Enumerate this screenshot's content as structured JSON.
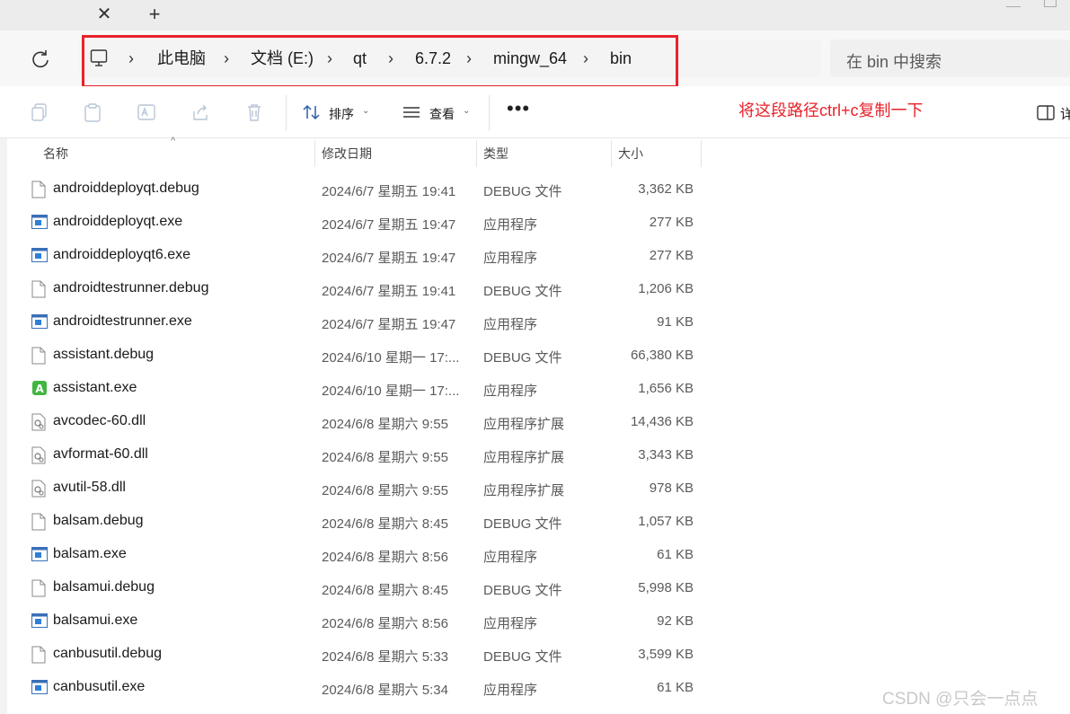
{
  "tabs": {
    "close_glyph": "✕",
    "new_glyph": "+"
  },
  "address": {
    "breadcrumbs": [
      "此电脑",
      "文档 (E:)",
      "qt",
      "6.7.2",
      "mingw_64",
      "bin"
    ],
    "separator": "›",
    "search_placeholder": "在 bin 中搜索",
    "highlight_color": "#e8222a"
  },
  "toolbar": {
    "sort_label": "排序",
    "view_label": "查看",
    "more_label": "•••",
    "detail_label": "详",
    "annotation": "将这段路径ctrl+c复制一下"
  },
  "columns": {
    "name": "名称",
    "date": "修改日期",
    "type": "类型",
    "size": "大小"
  },
  "files": [
    {
      "name": "androiddeployqt.debug",
      "date": "2024/6/7 星期五 19:41",
      "type": "DEBUG 文件",
      "size": "3,362 KB",
      "icon": "document-icon"
    },
    {
      "name": "androiddeployqt.exe",
      "date": "2024/6/7 星期五 19:47",
      "type": "应用程序",
      "size": "277 KB",
      "icon": "exe-icon"
    },
    {
      "name": "androiddeployqt6.exe",
      "date": "2024/6/7 星期五 19:47",
      "type": "应用程序",
      "size": "277 KB",
      "icon": "exe-icon"
    },
    {
      "name": "androidtestrunner.debug",
      "date": "2024/6/7 星期五 19:41",
      "type": "DEBUG 文件",
      "size": "1,206 KB",
      "icon": "document-icon"
    },
    {
      "name": "androidtestrunner.exe",
      "date": "2024/6/7 星期五 19:47",
      "type": "应用程序",
      "size": "91 KB",
      "icon": "exe-icon"
    },
    {
      "name": "assistant.debug",
      "date": "2024/6/10 星期一 17:...",
      "type": "DEBUG 文件",
      "size": "66,380 KB",
      "icon": "document-icon"
    },
    {
      "name": "assistant.exe",
      "date": "2024/6/10 星期一 17:...",
      "type": "应用程序",
      "size": "1,656 KB",
      "icon": "assistant-app-icon"
    },
    {
      "name": "avcodec-60.dll",
      "date": "2024/6/8 星期六 9:55",
      "type": "应用程序扩展",
      "size": "14,436 KB",
      "icon": "dll-icon"
    },
    {
      "name": "avformat-60.dll",
      "date": "2024/6/8 星期六 9:55",
      "type": "应用程序扩展",
      "size": "3,343 KB",
      "icon": "dll-icon"
    },
    {
      "name": "avutil-58.dll",
      "date": "2024/6/8 星期六 9:55",
      "type": "应用程序扩展",
      "size": "978 KB",
      "icon": "dll-icon"
    },
    {
      "name": "balsam.debug",
      "date": "2024/6/8 星期六 8:45",
      "type": "DEBUG 文件",
      "size": "1,057 KB",
      "icon": "document-icon"
    },
    {
      "name": "balsam.exe",
      "date": "2024/6/8 星期六 8:56",
      "type": "应用程序",
      "size": "61 KB",
      "icon": "exe-icon"
    },
    {
      "name": "balsamui.debug",
      "date": "2024/6/8 星期六 8:45",
      "type": "DEBUG 文件",
      "size": "5,998 KB",
      "icon": "document-icon"
    },
    {
      "name": "balsamui.exe",
      "date": "2024/6/8 星期六 8:56",
      "type": "应用程序",
      "size": "92 KB",
      "icon": "exe-icon"
    },
    {
      "name": "canbusutil.debug",
      "date": "2024/6/8 星期六 5:33",
      "type": "DEBUG 文件",
      "size": "3,599 KB",
      "icon": "document-icon"
    },
    {
      "name": "canbusutil.exe",
      "date": "2024/6/8 星期六 5:34",
      "type": "应用程序",
      "size": "61 KB",
      "icon": "exe-icon"
    }
  ],
  "watermark": "CSDN @只会一点点"
}
